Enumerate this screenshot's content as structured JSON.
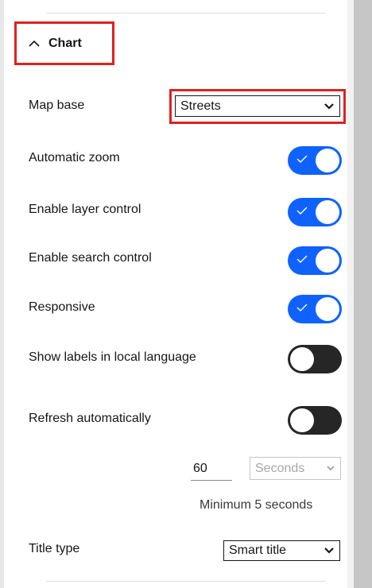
{
  "section": {
    "title": "Chart"
  },
  "map_base": {
    "label": "Map base",
    "value": "Streets"
  },
  "toggles": [
    {
      "label": "Automatic zoom",
      "state": true
    },
    {
      "label": "Enable layer control",
      "state": true
    },
    {
      "label": "Enable search control",
      "state": true
    },
    {
      "label": "Responsive",
      "state": true
    },
    {
      "label": "Show labels in local language",
      "state": false
    },
    {
      "label": "Refresh automatically",
      "state": false
    }
  ],
  "refresh": {
    "interval_value": "60",
    "unit_value": "Seconds",
    "helper": "Minimum 5 seconds"
  },
  "title_type": {
    "label": "Title type",
    "value": "Smart title"
  },
  "colors": {
    "accent": "#0f62fe",
    "toggle_off": "#262626",
    "highlight": "#e02020"
  }
}
